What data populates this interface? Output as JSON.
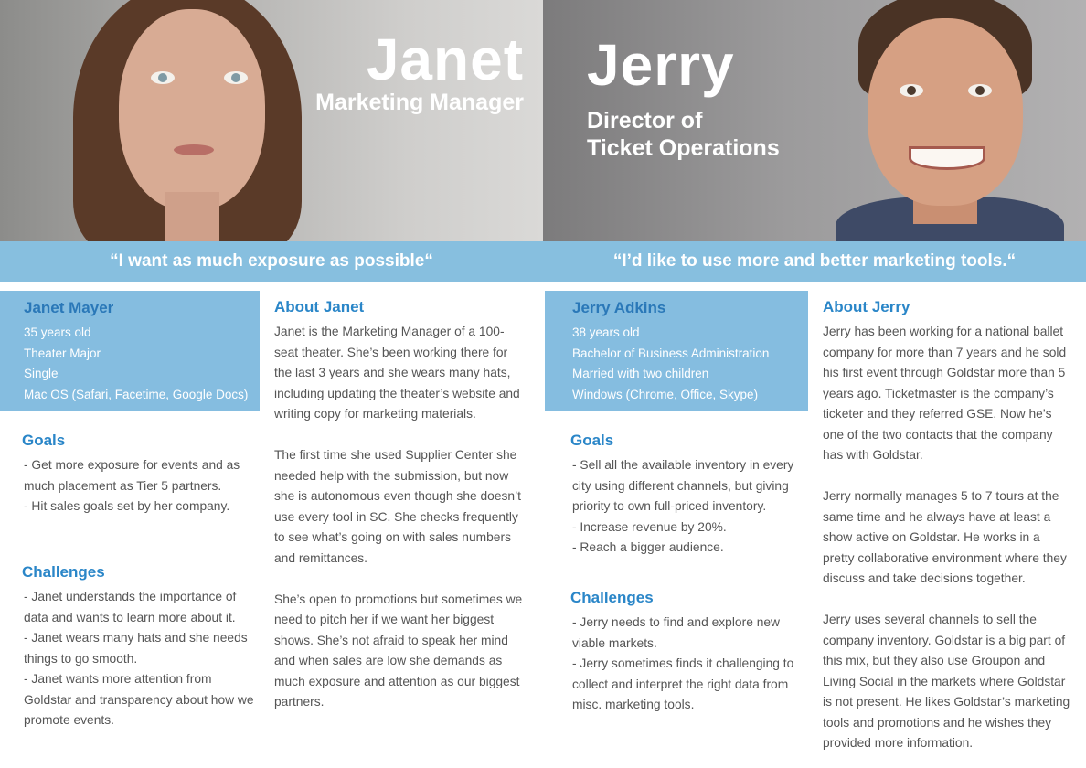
{
  "janet": {
    "name": "Janet",
    "title": "Marketing Manager",
    "quote": "“I want as much exposure as possible“",
    "profile": {
      "full_name": "Janet Mayer",
      "details": [
        "35 years old",
        "Theater Major",
        "Single",
        "Mac OS (Safari, Facetime, Google Docs)"
      ]
    },
    "goals_heading": "Goals",
    "goals": [
      "- Get more exposure for events and as much placement as Tier 5 partners.",
      "- Hit sales goals set by her company."
    ],
    "challenges_heading": "Challenges",
    "challenges": [
      "- Janet understands the importance of data and wants to learn more about it.",
      "- Janet wears many hats and she needs things to go smooth.",
      "- Janet wants more attention from Goldstar and transparency about how we promote events."
    ],
    "about_heading": "About Janet",
    "about": [
      "Janet is the Marketing Manager of a 100-seat theater. She’s been working there for the last 3 years and she wears many hats, including updating the theater’s website and writing copy for marketing materials.",
      "The first time she used Supplier Center she needed help with the submission, but now she is autonomous even though she doesn’t use every tool in SC. She checks frequently to see what’s going on with sales numbers and remittances.",
      "She’s open to promotions but sometimes we need to pitch her if we want her biggest shows. She’s not afraid to speak her mind and when sales are low she demands as much exposure and attention as our biggest partners."
    ]
  },
  "jerry": {
    "name": "Jerry",
    "title_line1": "Director of",
    "title_line2": "Ticket Operations",
    "quote": "“I’d like to use more and better marketing tools.“",
    "profile": {
      "full_name": "Jerry Adkins",
      "details": [
        "38 years old",
        "Bachelor of Business Administration",
        "Married with two children",
        "Windows (Chrome, Office, Skype)"
      ]
    },
    "goals_heading": "Goals",
    "goals": [
      "- Sell all the available inventory in every city using different channels, but giving priority to own full-priced inventory.",
      "- Increase revenue by 20%.",
      "- Reach a bigger audience."
    ],
    "challenges_heading": "Challenges",
    "challenges": [
      "- Jerry needs to find and explore new viable markets.",
      "- Jerry sometimes finds it challenging to collect and interpret the right data from misc. marketing tools."
    ],
    "about_heading": "About Jerry",
    "about": [
      "Jerry has been working for a national ballet company for more than 7 years and he sold his first event through Goldstar more than 5 years ago. Ticketmaster is the company’s ticketer and they referred GSE. Now he’s one of the two contacts that the company has with Goldstar.",
      "Jerry normally manages 5 to 7 tours at the same time and he always have at least a show active on Goldstar. He works in a pretty collaborative environment where they discuss and take decisions together.",
      "Jerry uses several channels to sell the company inventory. Goldstar is a big part of this mix, but they also use Groupon and Living Social in the markets where Goldstar is not present. He likes Goldstar’s marketing tools and promotions and he wishes they provided more information."
    ]
  },
  "colors": {
    "band_blue": "#87bfdf",
    "profile_blue": "#85bde0",
    "heading_blue": "#2a86c8",
    "name_blue": "#2a78b8"
  }
}
